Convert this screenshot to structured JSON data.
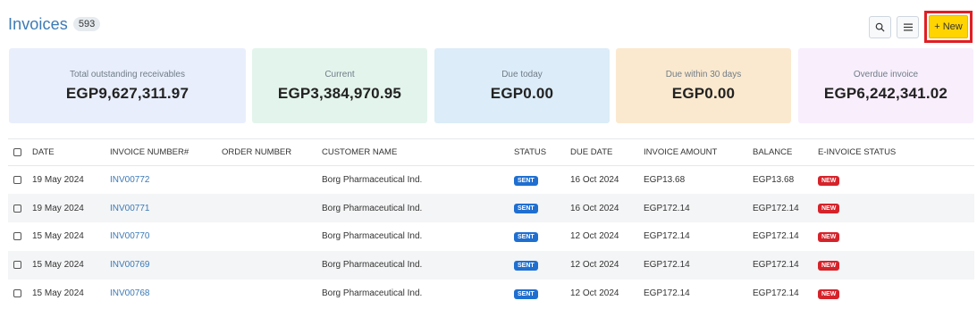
{
  "header": {
    "title": "Invoices",
    "count": "593"
  },
  "toolbar": {
    "new_label": "+ New",
    "search_icon": "search-icon",
    "menu_icon": "hamburger-menu-icon"
  },
  "summary_cards": [
    {
      "label": "Total outstanding receivables",
      "value": "EGP9,627,311.97",
      "bg": "#e8eefc"
    },
    {
      "label": "Current",
      "value": "EGP3,384,970.95",
      "bg": "#e3f4ec"
    },
    {
      "label": "Due today",
      "value": "EGP0.00",
      "bg": "#dcecf8"
    },
    {
      "label": "Due within 30 days",
      "value": "EGP0.00",
      "bg": "#fbe9cf"
    },
    {
      "label": "Overdue invoice",
      "value": "EGP6,242,341.02",
      "bg": "#f8eefc"
    }
  ],
  "table": {
    "columns": [
      "DATE",
      "INVOICE NUMBER#",
      "ORDER NUMBER",
      "CUSTOMER NAME",
      "STATUS",
      "DUE DATE",
      "INVOICE AMOUNT",
      "BALANCE",
      "E-INVOICE STATUS"
    ],
    "rows": [
      {
        "date": "19 May 2024",
        "invoice": "INV00772",
        "order": "",
        "customer": "Borg Pharmaceutical Ind.",
        "status": "SENT",
        "due": "16 Oct 2024",
        "amount": "EGP13.68",
        "balance": "EGP13.68",
        "einvoice": "NEW"
      },
      {
        "date": "19 May 2024",
        "invoice": "INV00771",
        "order": "",
        "customer": "Borg Pharmaceutical Ind.",
        "status": "SENT",
        "due": "16 Oct 2024",
        "amount": "EGP172.14",
        "balance": "EGP172.14",
        "einvoice": "NEW"
      },
      {
        "date": "15 May 2024",
        "invoice": "INV00770",
        "order": "",
        "customer": "Borg Pharmaceutical Ind.",
        "status": "SENT",
        "due": "12 Oct 2024",
        "amount": "EGP172.14",
        "balance": "EGP172.14",
        "einvoice": "NEW"
      },
      {
        "date": "15 May 2024",
        "invoice": "INV00769",
        "order": "",
        "customer": "Borg Pharmaceutical Ind.",
        "status": "SENT",
        "due": "12 Oct 2024",
        "amount": "EGP172.14",
        "balance": "EGP172.14",
        "einvoice": "NEW"
      },
      {
        "date": "15 May 2024",
        "invoice": "INV00768",
        "order": "",
        "customer": "Borg Pharmaceutical Ind.",
        "status": "SENT",
        "due": "12 Oct 2024",
        "amount": "EGP172.14",
        "balance": "EGP172.14",
        "einvoice": "NEW"
      }
    ]
  },
  "colors": {
    "accent": "#3c7ab7",
    "new_button": "#ffd400",
    "highlight": "#e01e24",
    "sent": "#1f6fd1",
    "new_badge": "#d6232a"
  }
}
